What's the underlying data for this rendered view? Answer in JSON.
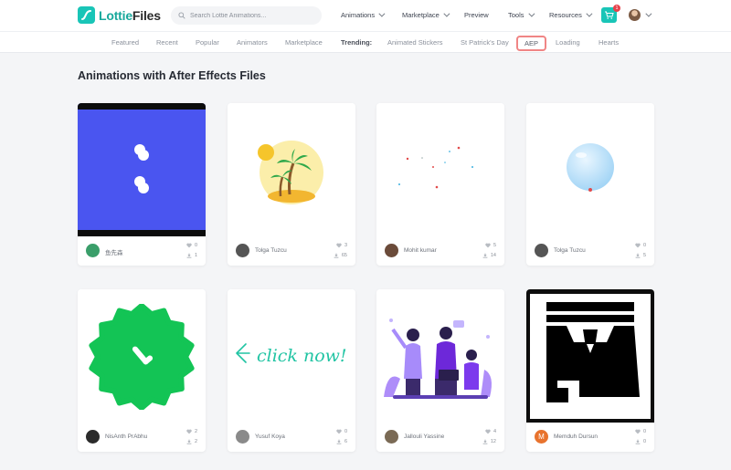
{
  "header": {
    "logo": {
      "brand_a": "Lottie",
      "brand_b": "Files"
    },
    "search": {
      "placeholder": "Search Lottie Animations..."
    },
    "nav": [
      {
        "label": "Animations",
        "dropdown": true
      },
      {
        "label": "Marketplace",
        "dropdown": true
      },
      {
        "label": "Preview",
        "dropdown": false
      },
      {
        "label": "Tools",
        "dropdown": true
      },
      {
        "label": "Resources",
        "dropdown": true
      }
    ],
    "cart": {
      "icon": "cart-icon",
      "badge": "1"
    },
    "accent_color": "#19c5b7"
  },
  "subnav": {
    "items": [
      {
        "label": "Featured"
      },
      {
        "label": "Recent"
      },
      {
        "label": "Popular"
      },
      {
        "label": "Animators"
      },
      {
        "label": "Marketplace"
      }
    ],
    "trending_label": "Trending:",
    "trending": [
      {
        "label": "Animated Stickers"
      },
      {
        "label": "St Patrick's Day"
      },
      {
        "label": "AEP",
        "active": true
      },
      {
        "label": "Loading"
      },
      {
        "label": "Hearts"
      }
    ]
  },
  "page": {
    "title": "Animations with After Effects Files"
  },
  "cards": [
    {
      "author": "鱼先森",
      "likes": "0",
      "downloads": "1",
      "thumb": "blue-dots",
      "avatar_color": "#3a9e6a"
    },
    {
      "author": "Tolga Tuzcu",
      "likes": "3",
      "downloads": "65",
      "thumb": "palm-island",
      "avatar_color": "#555555"
    },
    {
      "author": "Mohit kumar",
      "likes": "5",
      "downloads": "14",
      "thumb": "confetti",
      "avatar_color": "#6b4b3a"
    },
    {
      "author": "Tolga Tuzcu",
      "likes": "0",
      "downloads": "5",
      "thumb": "bubble",
      "avatar_color": "#555555"
    },
    {
      "author": "NisAnth PrAbhu",
      "likes": "2",
      "downloads": "2",
      "thumb": "green-badge",
      "avatar_color": "#2b2b2b"
    },
    {
      "author": "Yusuf Koya",
      "likes": "0",
      "downloads": "6",
      "thumb": "click-now",
      "avatar_color": "#8a8a8a",
      "thumb_text": "click now!"
    },
    {
      "author": "Jallouli Yassine",
      "likes": "4",
      "downloads": "12",
      "thumb": "team-illustration",
      "avatar_color": "#7a6a55"
    },
    {
      "author": "Memduh Dursun",
      "likes": "0",
      "downloads": "0",
      "thumb": "black-shape",
      "avatar_color": "#e8732e",
      "avatar_letter": "M"
    }
  ]
}
